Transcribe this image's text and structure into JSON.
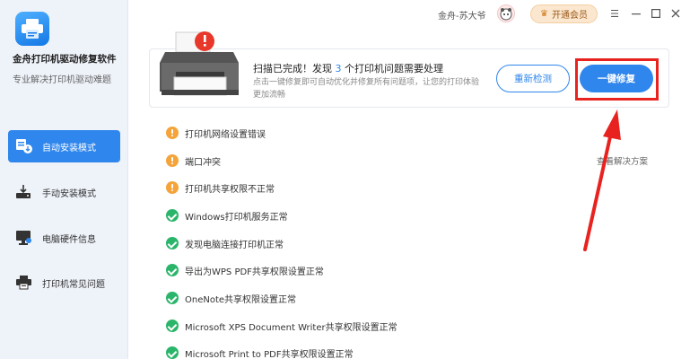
{
  "app": {
    "name": "金舟打印机驱动修复软件",
    "subtitle": "专业解决打印机驱动难题"
  },
  "sidebar": {
    "items": [
      {
        "label": "自动安装模式",
        "icon": "auto-install-icon",
        "active": true
      },
      {
        "label": "手动安装模式",
        "icon": "manual-install-icon",
        "active": false
      },
      {
        "label": "电脑硬件信息",
        "icon": "hardware-info-icon",
        "active": false
      },
      {
        "label": "打印机常见问题",
        "icon": "printer-faq-icon",
        "active": false
      }
    ]
  },
  "titlebar": {
    "username": "金舟-苏大爷",
    "vip_label": "开通会员"
  },
  "scan": {
    "title_before": "扫描已完成！发现 ",
    "count": "3",
    "title_after": " 个打印机问题需要处理",
    "description": "点击一键修复即可自动优化并修复所有问题项，让您的打印体验更加流畅",
    "rescan_label": "重新检测",
    "fix_label": "一键修复"
  },
  "issues": [
    {
      "text": "打印机网络设置错误",
      "status": "warn"
    },
    {
      "text": "端口冲突",
      "status": "warn"
    },
    {
      "text": "打印机共享权限不正常",
      "status": "warn"
    },
    {
      "text": "Windows打印机服务正常",
      "status": "ok"
    },
    {
      "text": "发现电脑连接打印机正常",
      "status": "ok"
    },
    {
      "text": "导出为WPS PDF共享权限设置正常",
      "status": "ok"
    },
    {
      "text": "OneNote共享权限设置正常",
      "status": "ok"
    },
    {
      "text": "Microsoft XPS Document Writer共享权限设置正常",
      "status": "ok"
    },
    {
      "text": "Microsoft Print to PDF共享权限设置正常",
      "status": "ok"
    }
  ],
  "view_solution_label": "查看解决方案",
  "colors": {
    "accent": "#2f86ec",
    "warn": "#f4a43a",
    "ok": "#2bb56a",
    "highlight": "#e8231f"
  }
}
